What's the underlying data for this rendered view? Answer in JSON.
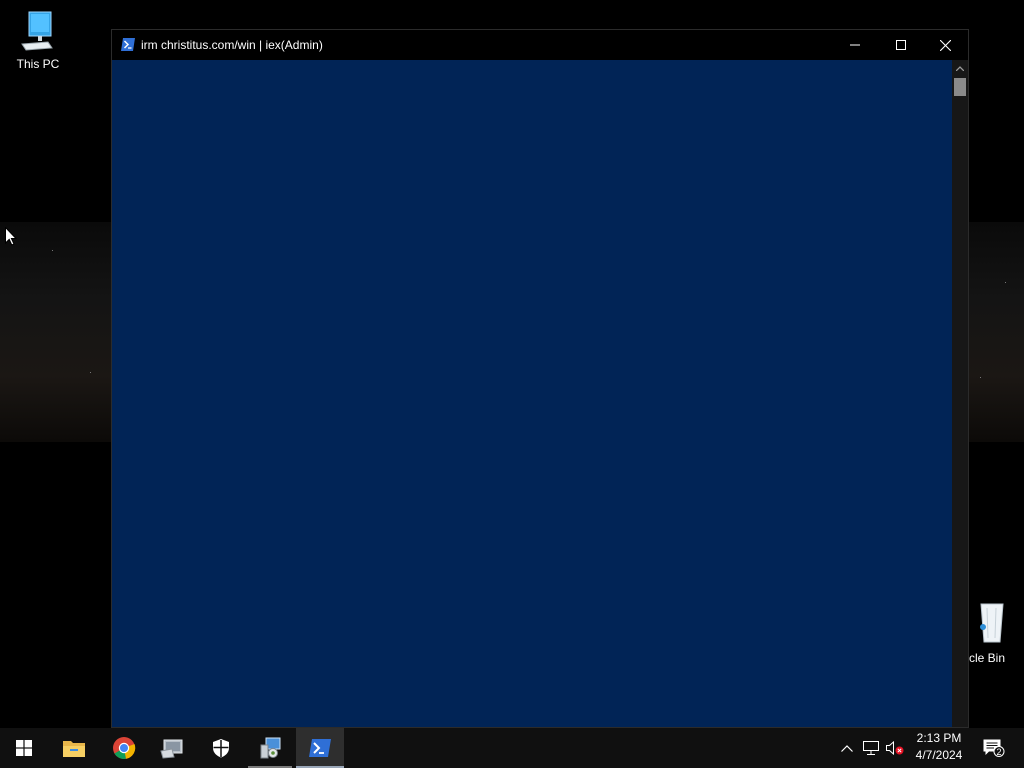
{
  "desktop": {
    "icons": [
      {
        "label": "This PC",
        "icon": "computer-icon"
      },
      {
        "label": "cle Bin",
        "icon": "recycle-bin-icon"
      }
    ]
  },
  "window": {
    "title": "irm christitus.com/win | iex(Admin)",
    "icon": "powershell-icon",
    "controls": {
      "minimize": "minimize-icon",
      "maximize": "maximize-icon",
      "close": "close-icon"
    },
    "console_color": "#012456"
  },
  "taskbar": {
    "apps": [
      {
        "name": "Start",
        "icon": "windows-logo-icon"
      },
      {
        "name": "File Explorer",
        "icon": "folder-icon"
      },
      {
        "name": "Google Chrome",
        "icon": "chrome-icon"
      },
      {
        "name": "Tool",
        "icon": "tool-icon"
      },
      {
        "name": "Windows Security",
        "icon": "shield-icon"
      },
      {
        "name": "Configuration",
        "icon": "config-icon"
      },
      {
        "name": "Windows PowerShell",
        "icon": "powershell-icon",
        "active": true
      }
    ],
    "tray": {
      "time": "2:13 PM",
      "date": "4/7/2024",
      "notification_count": "2"
    }
  }
}
